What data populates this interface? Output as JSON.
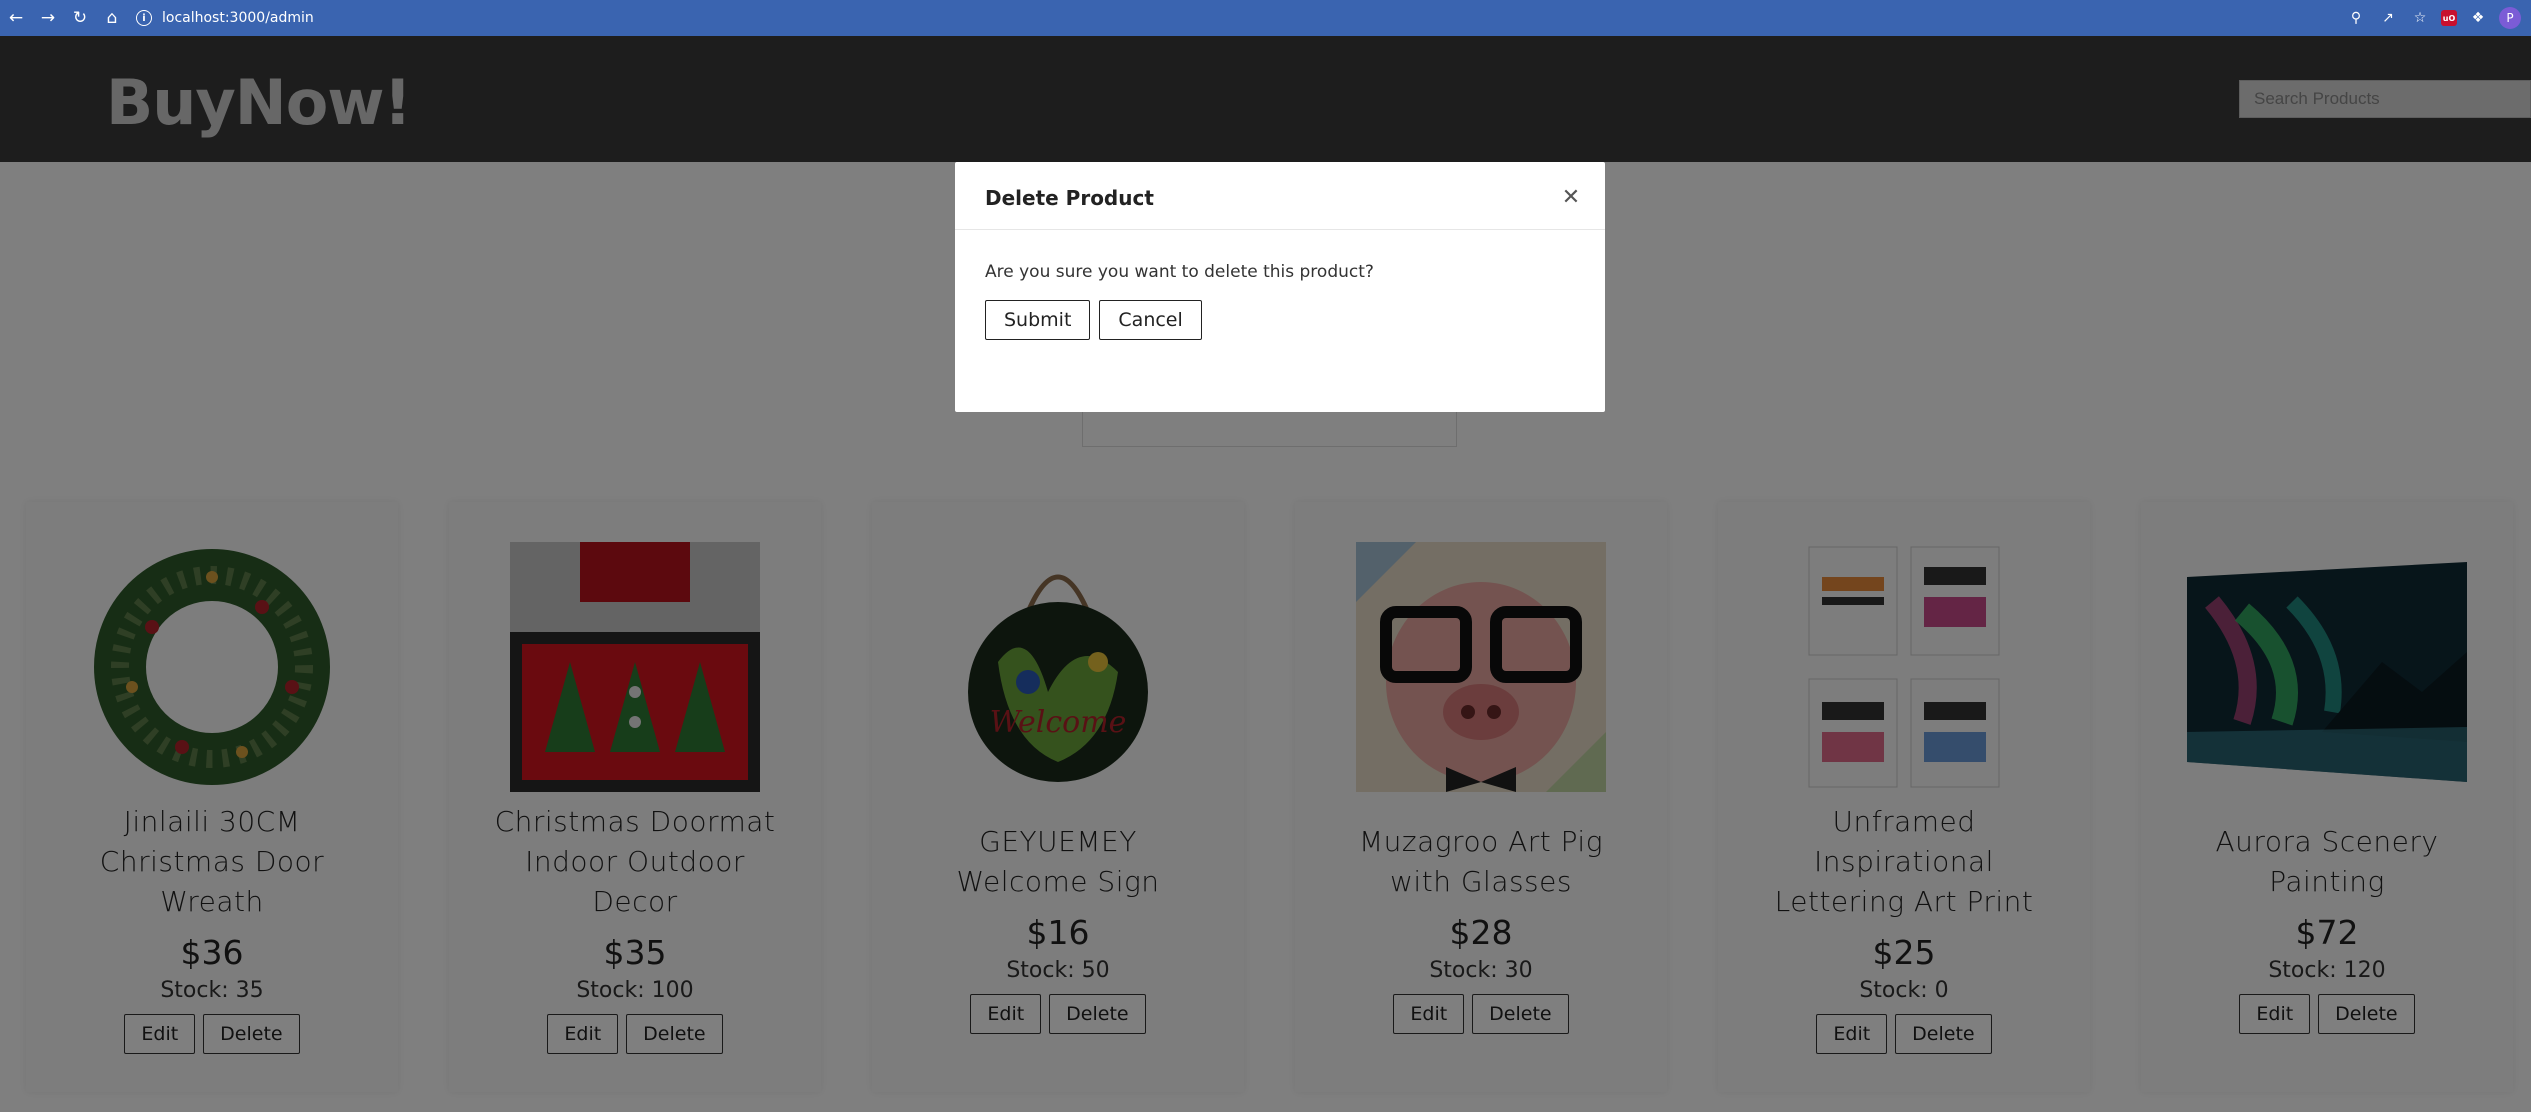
{
  "browser": {
    "url": "localhost:3000/admin",
    "profile_initial": "P",
    "extension_badge": "uO"
  },
  "header": {
    "brand": "BuyNow!",
    "search_placeholder": "Search Products"
  },
  "products": [
    {
      "title": "Jinlaili 30CM Christmas Door Wreath",
      "price": "$36",
      "stock": "Stock: 35",
      "edit_label": "Edit",
      "delete_label": "Delete"
    },
    {
      "title": "Christmas Doormat Indoor Outdoor Decor",
      "price": "$35",
      "stock": "Stock: 100",
      "edit_label": "Edit",
      "delete_label": "Delete"
    },
    {
      "title": "GEYUEMEY Welcome Sign",
      "price": "$16",
      "stock": "Stock: 50",
      "edit_label": "Edit",
      "delete_label": "Delete"
    },
    {
      "title": "Muzagroo Art Pig with Glasses",
      "price": "$28",
      "stock": "Stock: 30",
      "edit_label": "Edit",
      "delete_label": "Delete"
    },
    {
      "title": "Unframed Inspirational Lettering Art Print",
      "price": "$25",
      "stock": "Stock: 0",
      "edit_label": "Edit",
      "delete_label": "Delete"
    },
    {
      "title": "Aurora Scenery Painting",
      "price": "$72",
      "stock": "Stock: 120",
      "edit_label": "Edit",
      "delete_label": "Delete"
    }
  ],
  "modal": {
    "title": "Delete Product",
    "message": "Are you sure you want to delete this product?",
    "submit_label": "Submit",
    "cancel_label": "Cancel"
  },
  "colors": {
    "browser_bar": "#3a64b0",
    "header_bg": "#3a3a3a",
    "overlay": "rgba(0,0,0,0.5)"
  }
}
